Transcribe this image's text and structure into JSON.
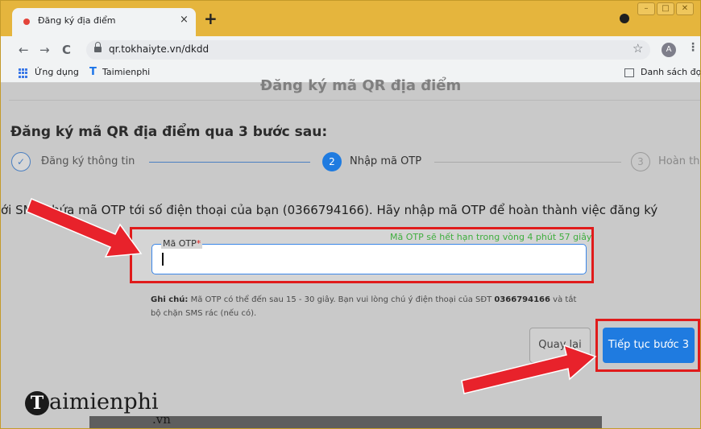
{
  "browser": {
    "tab": {
      "title": "Đăng ký địa điểm",
      "close": "×"
    },
    "new_tab": "+",
    "window_controls": {
      "minimize": "–",
      "maximize": "□",
      "close": "✕"
    },
    "nav": {
      "back": "←",
      "forward": "→",
      "reload": "C"
    },
    "url": "qr.tokhaiyte.vn/dkdd",
    "star": "☆",
    "avatar": "A",
    "menu": "⋮",
    "bookmarks": {
      "apps": "Ứng dụng",
      "taimienphi_icon": "T",
      "taimienphi": "Taimienphi",
      "reading_list": "Danh sách đọc"
    }
  },
  "page": {
    "partial_header": "Đăng ký mã QR địa điểm",
    "heading": "Đăng ký mã QR địa điểm qua 3 bước sau:",
    "steps": [
      {
        "marker": "✓",
        "label": "Đăng ký thông tin",
        "state": "done"
      },
      {
        "marker": "2",
        "label": "Nhập mã OTP",
        "state": "active"
      },
      {
        "marker": "3",
        "label": "Hoàn th",
        "state": "pending"
      }
    ],
    "sms_message": "ới SMS chứa mã OTP tới số điện thoại của bạn (0366794166). Hãy nhập mã OTP để hoàn thành việc đăng ký",
    "otp": {
      "label": "Mã OTP",
      "required_mark": "*",
      "value": "",
      "expiry": "Mã OTP sẽ hết hạn trong vòng 4 phút 57 giây"
    },
    "note": {
      "prefix": "Ghi chú:",
      "text_1": "Mã OTP có thể đến sau 15 - 30 giây. Bạn vui lòng chú ý điện thoại của SĐT",
      "phone": "0366794166",
      "text_2": "và tắt bộ chặn SMS rác (nếu có)."
    },
    "buttons": {
      "back": "Quay lại",
      "next": "Tiếp tục bước 3"
    }
  },
  "watermark": {
    "initial": "T",
    "text": "aimienphi",
    "suffix": ".vn"
  },
  "colors": {
    "accent": "#1f7be0",
    "highlight": "#e01b1b",
    "chrome": "#e5b53d",
    "expiry": "#3fae3f"
  }
}
